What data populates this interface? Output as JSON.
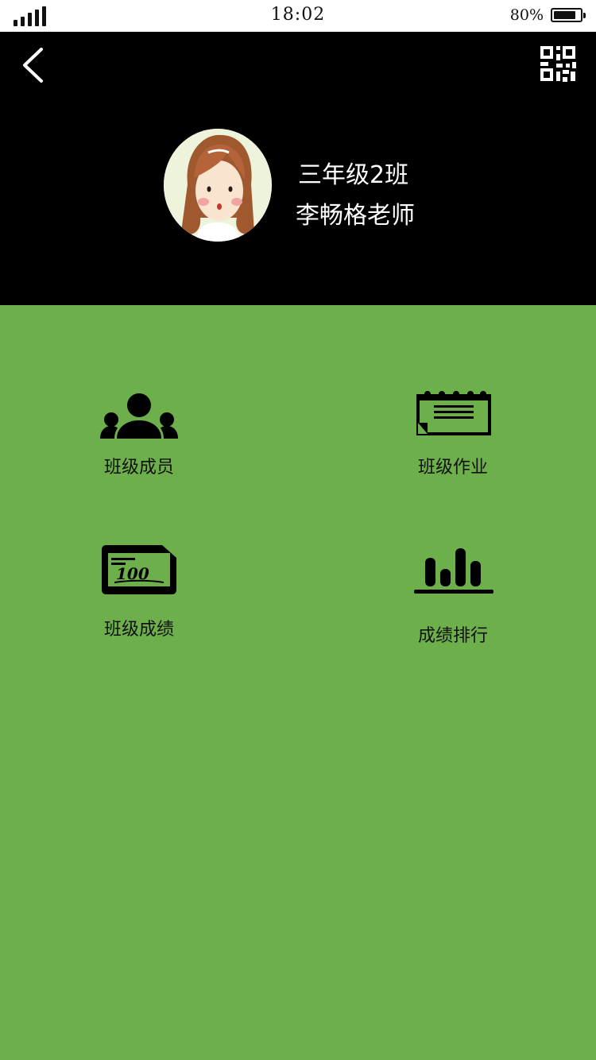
{
  "status_bar": {
    "time": "18:02",
    "battery_percent": "80%",
    "battery_level": 0.8,
    "signal_bars": 5
  },
  "header": {
    "back_icon": "chevron-left-icon",
    "qr_icon": "qr-code-icon",
    "avatar_icon": "teacher-avatar",
    "class_name": "三年级2班",
    "teacher_name": "李畅格老师"
  },
  "menu": {
    "members": {
      "label": "班级成员",
      "icon": "group-icon"
    },
    "homework": {
      "label": "班级作业",
      "icon": "notebook-icon"
    },
    "scores": {
      "label": "班级成绩",
      "icon": "score-sheet-icon",
      "icon_text": "100"
    },
    "ranking": {
      "label": "成绩排行",
      "icon": "bar-chart-icon"
    }
  },
  "colors": {
    "header_bg": "#000000",
    "body_bg": "#6caf4b",
    "status_bg": "#ffffff",
    "text_light": "#ffffff",
    "text_dark": "#111111"
  }
}
